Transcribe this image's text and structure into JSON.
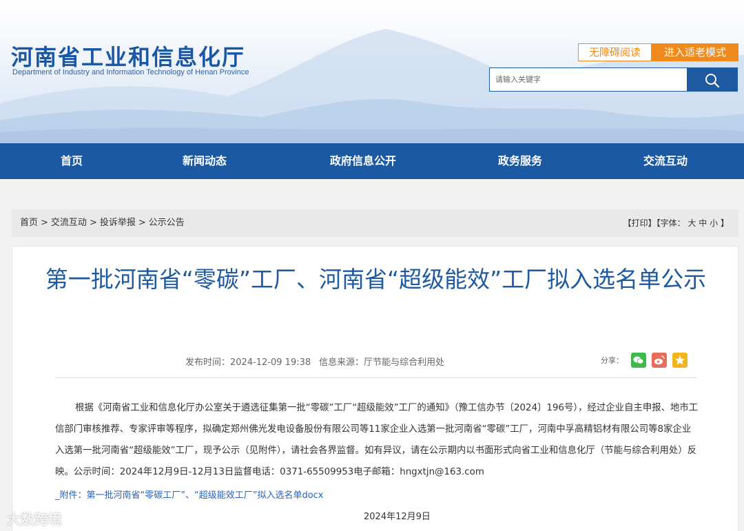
{
  "header": {
    "title": "河南省工业和信息化厅",
    "subtitle": "Department of Industry and Information Technology of Henan Province",
    "accessibility_label": "无障碍阅读",
    "elder_mode_label": "进入适老模式",
    "search_placeholder": "请输入关键字",
    "search_icon": "search-icon"
  },
  "nav": {
    "items": [
      {
        "label": "首页"
      },
      {
        "label": "新闻动态"
      },
      {
        "label": "政府信息公开"
      },
      {
        "label": "政务服务"
      },
      {
        "label": "交流互动"
      }
    ]
  },
  "breadcrumb": {
    "items": [
      "首页",
      "交流互动",
      "投诉举报",
      "公示公告"
    ],
    "separator": ">"
  },
  "tools": {
    "print": "【打印】",
    "font_label": "【字体：",
    "font_large": "大",
    "font_medium": "中",
    "font_small": "小",
    "font_close": "】"
  },
  "article": {
    "title": "第一批河南省“零碳”工厂、河南省“超级能效”工厂拟入选名单公示",
    "publish_time": "发布时间：2024-12-09 19:38",
    "source": "信息来源：厅节能与综合利用处",
    "share_label": "分享：",
    "share_icons": [
      "wechat-icon",
      "weibo-icon",
      "favorite-icon"
    ],
    "body": "根据《河南省工业和信息化厅办公室关于遴选征集第一批“零碳”工厂“超级能效”工厂的通知》（豫工信办节〔2024〕196号），经过企业自主申报、地市工信部门审核推荐、专家评审等程序，拟确定郑州佛光发电设备股份有限公司等11家企业入选第一批河南省“零碳”工厂，河南中孚高精铝材有限公司等8家企业入选第一批河南省“超级能效”工厂，现予公示（见附件），请社会各界监督。如有异议，请在公示期内以书面形式向省工业和信息化厅（节能与综合利用处）反映。公示时间：2024年12月9日-12月13日监督电话：0371-65509953电子邮箱：hngxtjn@163.com",
    "attachment": "_附件：第一批河南省“零碳工厂”、“超级能效工厂”拟入选名单docx",
    "date": "2024年12月9日"
  },
  "watermark": "大数跨境",
  "colors": {
    "brand_blue": "#1b5aa2",
    "accent_orange": "#f08a1c",
    "title_blue": "#1d5aa0",
    "link_blue": "#2a62b8"
  }
}
